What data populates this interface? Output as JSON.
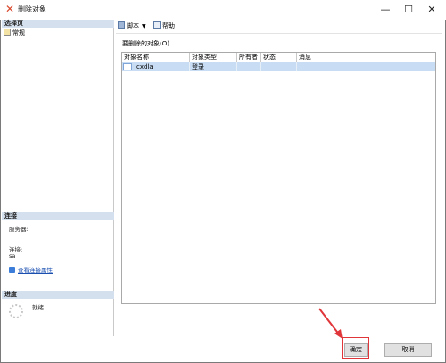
{
  "window": {
    "title": "删除对象",
    "controls": {
      "minimize": "—",
      "maximize": "☐",
      "close": "✕"
    }
  },
  "left": {
    "select_page_header": "选择页",
    "nav_items": [
      "常规"
    ],
    "connection_header": "连接",
    "server_label": "服务器:",
    "connection_label": "连接:",
    "connection_value": "sa",
    "view_connection_link": "查看连接属性",
    "progress_header": "进度",
    "progress_status": "就绪"
  },
  "toolbar": {
    "script_label": "脚本",
    "help_label": "帮助"
  },
  "main": {
    "objects_label": "要删除的对象(O)",
    "columns": [
      "对象名称",
      "对象类型",
      "所有者",
      "状态",
      "消息"
    ],
    "rows": [
      {
        "name": "cxdla",
        "type": "登录",
        "owner": "",
        "status": "",
        "message": ""
      }
    ]
  },
  "buttons": {
    "ok_label": "确定",
    "cancel_label": "取消"
  },
  "colors": {
    "section_header": "#d4e0ee",
    "selected_row": "#c8dcf3",
    "highlight": "#e0363a"
  }
}
